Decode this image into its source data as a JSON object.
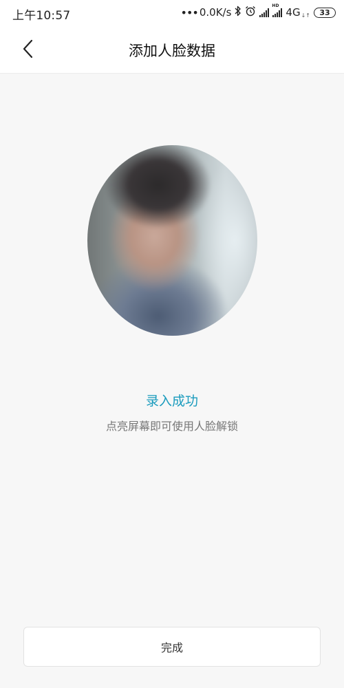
{
  "status_bar": {
    "time": "上午10:57",
    "network_speed": "0.0K/s",
    "network_type": "4G",
    "battery_level": "33",
    "icons": [
      "more-dots-icon",
      "bluetooth-icon",
      "alarm-icon",
      "signal-icon",
      "hd-signal-icon",
      "battery-icon"
    ]
  },
  "nav": {
    "title": "添加人脸数据",
    "back_icon": "chevron-left-icon"
  },
  "result": {
    "title": "录入成功",
    "hint": "点亮屏幕即可使用人脸解锁"
  },
  "footer": {
    "done_label": "完成"
  },
  "colors": {
    "accent": "#1a9bbd",
    "background": "#f7f7f7",
    "surface": "#ffffff",
    "hint": "#777777"
  }
}
